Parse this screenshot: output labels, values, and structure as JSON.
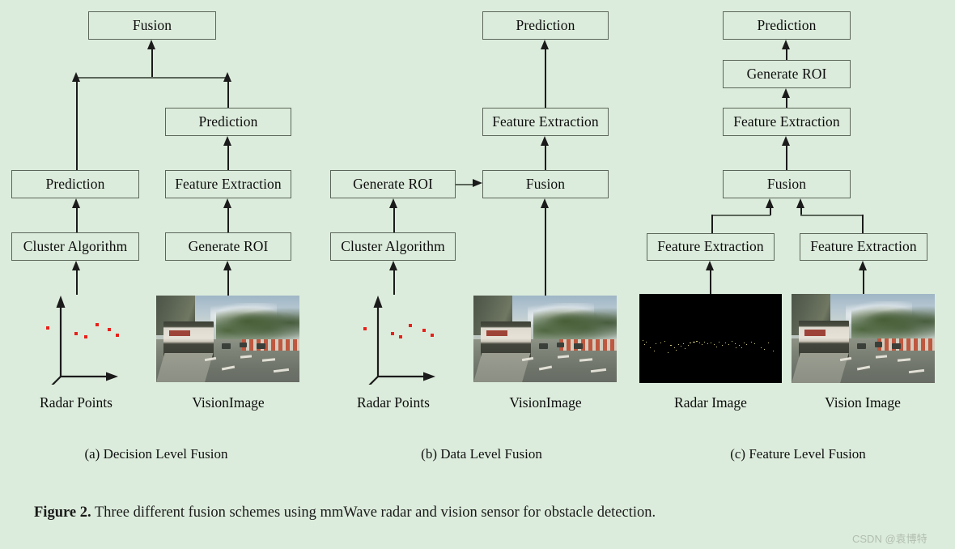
{
  "figure": {
    "label": "Figure 2.",
    "text": "Three different fusion schemes using mmWave radar and vision sensor for obstacle detection."
  },
  "watermark": "CSDN @袁博特",
  "colors": {
    "background": "#dcecdc",
    "box_border": "#5a665a",
    "arrow": "#1b1b1b",
    "radar_point": "#e8201a",
    "text": "#0d0d0d"
  },
  "panels": [
    {
      "id": "a",
      "subcaption": "(a) Decision Level Fusion",
      "nodes": {
        "fusion": "Fusion",
        "prediction_right": "Prediction",
        "prediction_left": "Prediction",
        "feature_extraction": "Feature Extraction",
        "cluster_algorithm": "Cluster Algorithm",
        "generate_roi": "Generate ROI"
      },
      "inputs": [
        {
          "type": "radar-points-plot",
          "label": "Radar Points"
        },
        {
          "type": "vision-photo",
          "label": "VisionImage"
        }
      ]
    },
    {
      "id": "b",
      "subcaption": "(b) Data Level Fusion",
      "nodes": {
        "prediction": "Prediction",
        "feature_extraction": "Feature Extraction",
        "fusion": "Fusion",
        "generate_roi": "Generate ROI",
        "cluster_algorithm": "Cluster Algorithm"
      },
      "inputs": [
        {
          "type": "radar-points-plot",
          "label": "Radar Points"
        },
        {
          "type": "vision-photo",
          "label": "VisionImage"
        }
      ]
    },
    {
      "id": "c",
      "subcaption": "(c) Feature Level Fusion",
      "nodes": {
        "prediction": "Prediction",
        "generate_roi": "Generate ROI",
        "feature_extraction_top": "Feature Extraction",
        "fusion": "Fusion",
        "feature_extraction_left": "Feature Extraction",
        "feature_extraction_right": "Feature Extraction"
      },
      "inputs": [
        {
          "type": "radar-photo",
          "label": "Radar Image"
        },
        {
          "type": "vision-photo",
          "label": "Vision Image"
        }
      ]
    }
  ]
}
